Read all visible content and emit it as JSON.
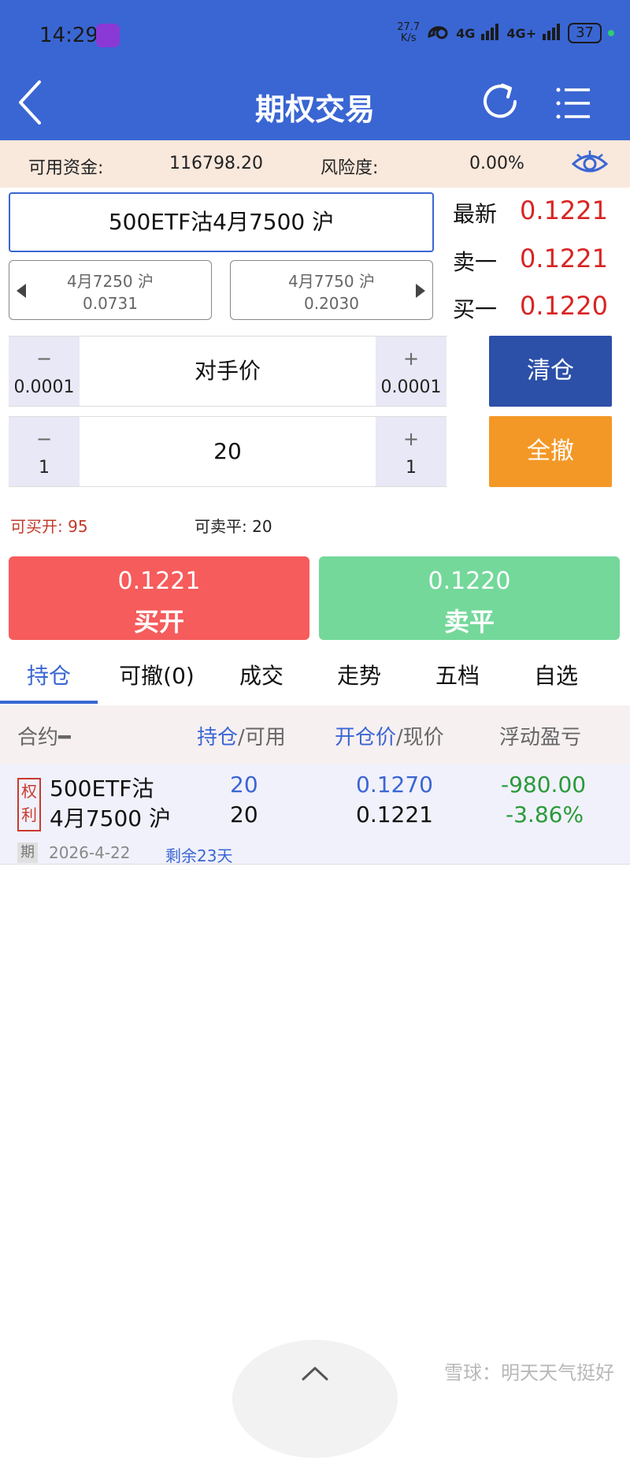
{
  "status_bar": {
    "time": "14:29",
    "net_speed_value": "27.7",
    "net_speed_unit": "K/s",
    "signal1": "4G",
    "signal2": "4G+",
    "battery": "37"
  },
  "nav": {
    "title": "期权交易"
  },
  "funds": {
    "available_label": "可用资金:",
    "available_value": "116798.20",
    "risk_label": "风险度:",
    "risk_value": "0.00%"
  },
  "contract": {
    "name": "500ETF沽4月7500 沪"
  },
  "neighbors": {
    "prev_name": "4月7250 沪",
    "prev_price": "0.0731",
    "next_name": "4月7750 沪",
    "next_price": "0.2030"
  },
  "quotes": {
    "latest_label": "最新",
    "latest_value": "0.1221",
    "ask_label": "卖一",
    "ask_value": "0.1221",
    "bid_label": "买一",
    "bid_value": "0.1220"
  },
  "price_stepper": {
    "minus_symbol": "−",
    "minus_step": "0.0001",
    "value": "对手价",
    "plus_symbol": "+",
    "plus_step": "0.0001"
  },
  "qty_stepper": {
    "minus_symbol": "−",
    "minus_step": "1",
    "value": "20",
    "plus_symbol": "+",
    "plus_step": "1"
  },
  "actions": {
    "close_all_label": "清仓",
    "cancel_all_label": "全撤"
  },
  "availability": {
    "can_buy_open": "可买开: 95",
    "can_sell_close": "可卖平: 20"
  },
  "trade": {
    "buy_price": "0.1221",
    "buy_label": "买开",
    "sell_price": "0.1220",
    "sell_label": "卖平"
  },
  "tabs": [
    "持仓",
    "可撤(0)",
    "成交",
    "走势",
    "五档",
    "自选"
  ],
  "table": {
    "col_contract": "合约",
    "col_contract_suffix": "━",
    "col_position_a": "持仓",
    "col_position_b": "/可用",
    "col_price_a": "开仓价",
    "col_price_b": "/现价",
    "col_pnl": "浮动盈亏"
  },
  "position": {
    "tag_line1": "权",
    "tag_line2": "利",
    "name_line1": "500ETF沽",
    "name_line2": "4月7500 沪",
    "holding": "20",
    "available": "20",
    "open_price": "0.1270",
    "current_price": "0.1221",
    "pnl_amount": "-980.00",
    "pnl_percent": "-3.86%",
    "expiry_badge": "期",
    "expiry_date": "2026-4-22",
    "remaining": "剩余23天"
  },
  "watermark": "雪球：明天天气挺好",
  "colors": {
    "brand_blue": "#3a66d3",
    "up_red": "#d82424",
    "down_green": "#2a9a3a",
    "buy_button": "#f65c5c",
    "sell_button": "#74d89a",
    "close_all_button": "#2c4fa8",
    "cancel_all_button": "#f39826"
  }
}
